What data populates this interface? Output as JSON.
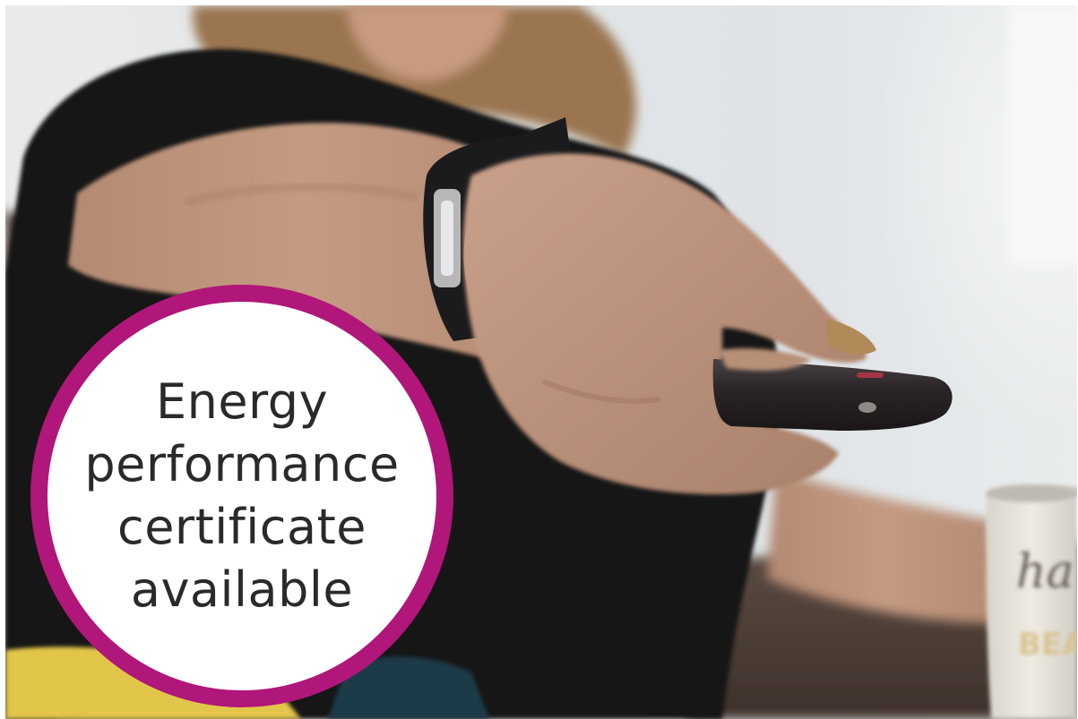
{
  "badge": {
    "lines": [
      "Energy",
      "performance",
      "certificate",
      "available"
    ],
    "ring_color": "#b1167a",
    "fill_color": "#ffffff",
    "text_color": "#2a2a2a"
  },
  "photo": {
    "mug_text": [
      "ha",
      "BEAU"
    ]
  }
}
